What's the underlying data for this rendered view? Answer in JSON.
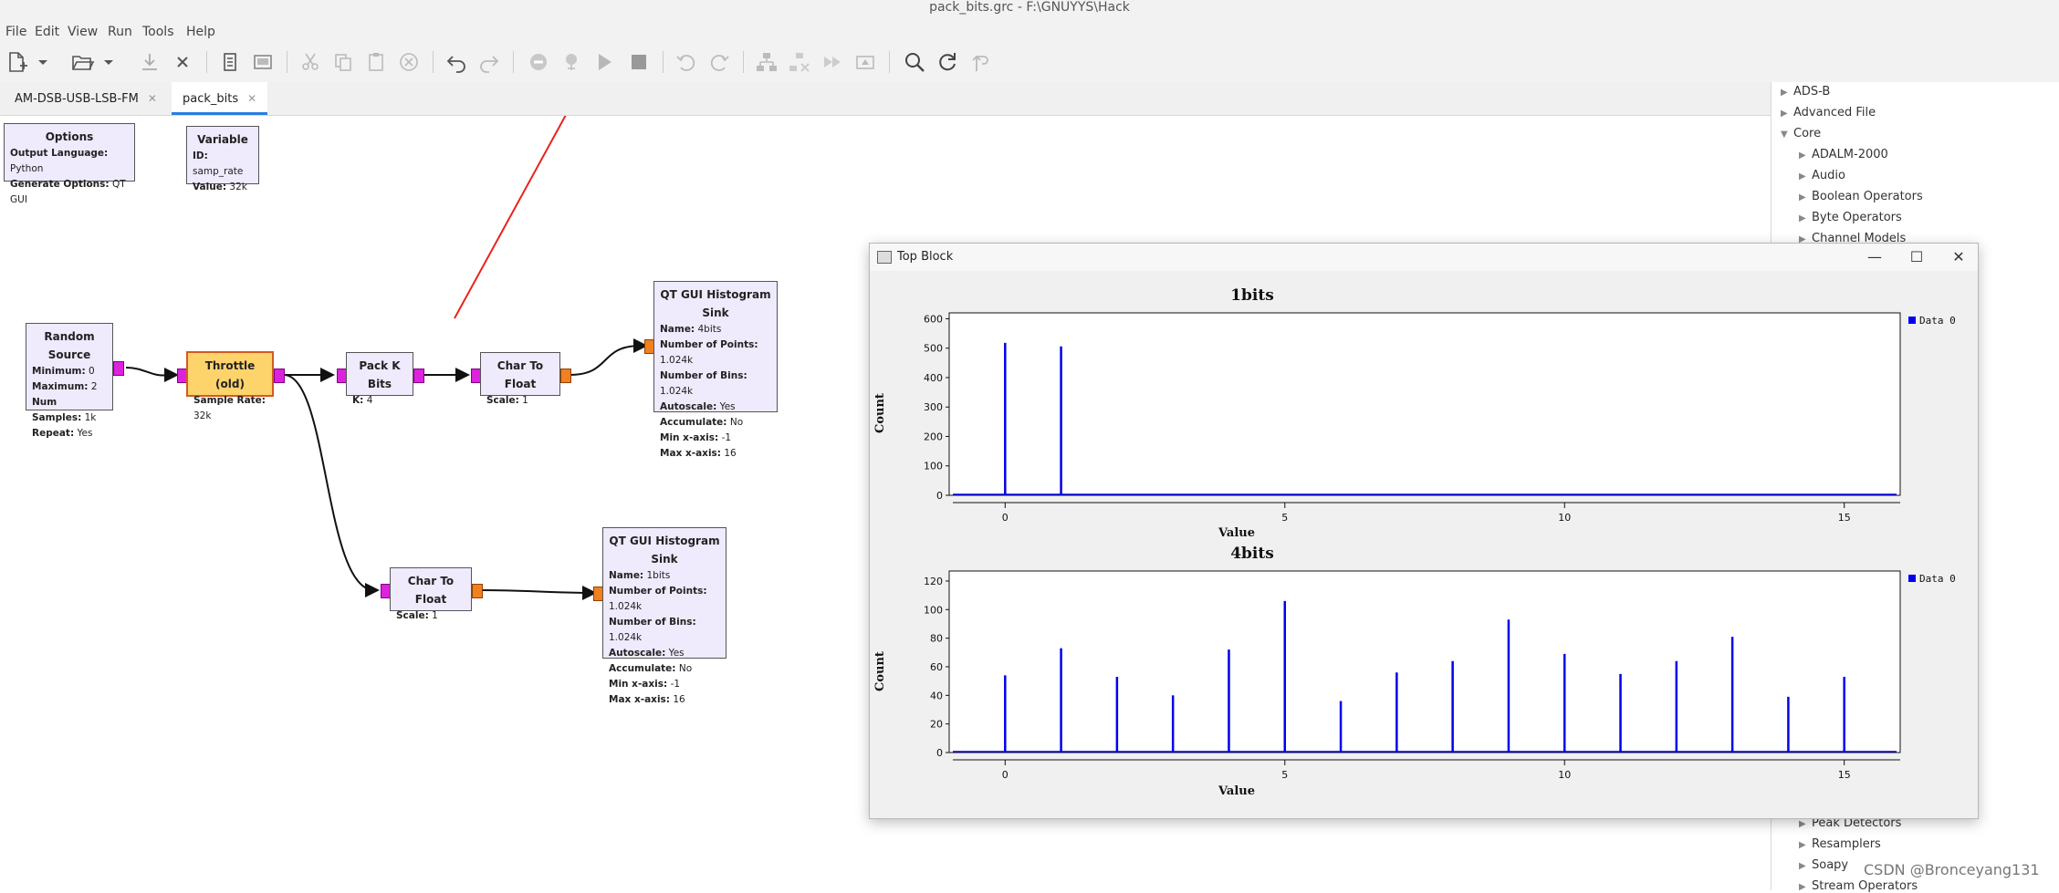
{
  "window": {
    "title": "pack_bits.grc - F:\\GNUYYS\\Hack"
  },
  "menu": {
    "items": [
      "File",
      "Edit",
      "View",
      "Run",
      "Tools",
      "Help"
    ]
  },
  "toolbar": {
    "icons": [
      "new-icon",
      "new-dropdown-icon",
      "open-icon",
      "open-dropdown-icon",
      "save-icon",
      "close-icon",
      "print-icon",
      "screenshot-icon",
      "cut-icon",
      "copy-icon",
      "paste-icon",
      "delete-icon",
      "undo-icon",
      "redo-icon",
      "disable-icon",
      "bypass-icon",
      "run-icon",
      "stop-icon",
      "rotate-ccw-icon",
      "rotate-cw-icon",
      "generate-icon",
      "kill-icon",
      "skip-icon",
      "show-errors-icon",
      "find-icon",
      "reload-icon",
      "nav-icon"
    ]
  },
  "tabs": [
    {
      "label": "AM-DSB-USB-LSB-FM",
      "close": "✕"
    },
    {
      "label": "pack_bits",
      "close": "✕"
    }
  ],
  "blocks": {
    "options": {
      "title": "Options",
      "params": [
        {
          "k": "Output Language:",
          "v": "Python"
        },
        {
          "k": "Generate Options:",
          "v": "QT GUI"
        }
      ]
    },
    "variable": {
      "title": "Variable",
      "params": [
        {
          "k": "ID:",
          "v": "samp_rate"
        },
        {
          "k": "Value:",
          "v": "32k"
        }
      ]
    },
    "random_source": {
      "title": "Random Source",
      "params": [
        {
          "k": "Minimum:",
          "v": "0"
        },
        {
          "k": "Maximum:",
          "v": "2"
        },
        {
          "k": "Num Samples:",
          "v": "1k"
        },
        {
          "k": "Repeat:",
          "v": "Yes"
        }
      ]
    },
    "throttle": {
      "title": "Throttle (old)",
      "params": [
        {
          "k": "Sample Rate:",
          "v": "32k"
        }
      ]
    },
    "pack_k_bits": {
      "title": "Pack K Bits",
      "params": [
        {
          "k": "K:",
          "v": "4"
        }
      ]
    },
    "char_to_float_1": {
      "title": "Char To Float",
      "params": [
        {
          "k": "Scale:",
          "v": "1"
        }
      ]
    },
    "char_to_float_2": {
      "title": "Char To Float",
      "params": [
        {
          "k": "Scale:",
          "v": "1"
        }
      ]
    },
    "hist_sink_4bits": {
      "title": "QT GUI Histogram Sink",
      "params": [
        {
          "k": "Name:",
          "v": "4bits"
        },
        {
          "k": "Number of Points:",
          "v": "1.024k"
        },
        {
          "k": "Number of Bins:",
          "v": "1.024k"
        },
        {
          "k": "Autoscale:",
          "v": "Yes"
        },
        {
          "k": "Accumulate:",
          "v": "No"
        },
        {
          "k": "Min x-axis:",
          "v": "-1"
        },
        {
          "k": "Max x-axis:",
          "v": "16"
        }
      ]
    },
    "hist_sink_1bits": {
      "title": "QT GUI Histogram Sink",
      "params": [
        {
          "k": "Name:",
          "v": "1bits"
        },
        {
          "k": "Number of Points:",
          "v": "1.024k"
        },
        {
          "k": "Number of Bins:",
          "v": "1.024k"
        },
        {
          "k": "Autoscale:",
          "v": "Yes"
        },
        {
          "k": "Accumulate:",
          "v": "No"
        },
        {
          "k": "Min x-axis:",
          "v": "-1"
        },
        {
          "k": "Max x-axis:",
          "v": "16"
        }
      ]
    }
  },
  "tree": {
    "items": [
      {
        "label": "ADS-B",
        "level": 0,
        "expanded": false
      },
      {
        "label": "Advanced File",
        "level": 0,
        "expanded": false
      },
      {
        "label": "Core",
        "level": 0,
        "expanded": true
      },
      {
        "label": "ADALM-2000",
        "level": 1,
        "expanded": false
      },
      {
        "label": "Audio",
        "level": 1,
        "expanded": false
      },
      {
        "label": "Boolean Operators",
        "level": 1,
        "expanded": false
      },
      {
        "label": "Byte Operators",
        "level": 1,
        "expanded": false
      },
      {
        "label": "Channel Models",
        "level": 1,
        "expanded": false
      }
    ],
    "bottom_items": [
      {
        "label": "Peak Detectors",
        "level": 1
      },
      {
        "label": "Resamplers",
        "level": 1
      },
      {
        "label": "Soapy",
        "level": 1
      },
      {
        "label": "Stream Operators",
        "level": 1
      }
    ]
  },
  "topblock": {
    "title": "Top Block",
    "controls": {
      "minimize": "—",
      "maximize": "☐",
      "close": "✕"
    }
  },
  "chart_data": [
    {
      "type": "bar",
      "title": "1bits",
      "xlabel": "Value",
      "ylabel": "Count",
      "xlim": [
        -1,
        16
      ],
      "ylim": [
        0,
        620
      ],
      "xticks": [
        0,
        5,
        10,
        15
      ],
      "yticks": [
        0,
        100,
        200,
        300,
        400,
        500,
        600
      ],
      "legend": "top-right",
      "series": [
        {
          "name": "Data 0",
          "color": "#0000ee",
          "x": [
            0,
            1
          ],
          "values": [
            518,
            506
          ]
        }
      ]
    },
    {
      "type": "bar",
      "title": "4bits",
      "xlabel": "Value",
      "ylabel": "Count",
      "xlim": [
        -1,
        16
      ],
      "ylim": [
        0,
        127
      ],
      "xticks": [
        0,
        5,
        10,
        15
      ],
      "yticks": [
        0,
        20,
        40,
        60,
        80,
        100,
        120
      ],
      "legend": "top-right",
      "series": [
        {
          "name": "Data 0",
          "color": "#0000ee",
          "x": [
            0,
            1,
            2,
            3,
            4,
            5,
            6,
            7,
            8,
            9,
            10,
            11,
            12,
            13,
            14,
            15
          ],
          "values": [
            54,
            73,
            53,
            40,
            72,
            106,
            36,
            56,
            64,
            93,
            69,
            55,
            64,
            81,
            39,
            53
          ]
        }
      ]
    }
  ],
  "watermark": "CSDN @Bronceyang131"
}
